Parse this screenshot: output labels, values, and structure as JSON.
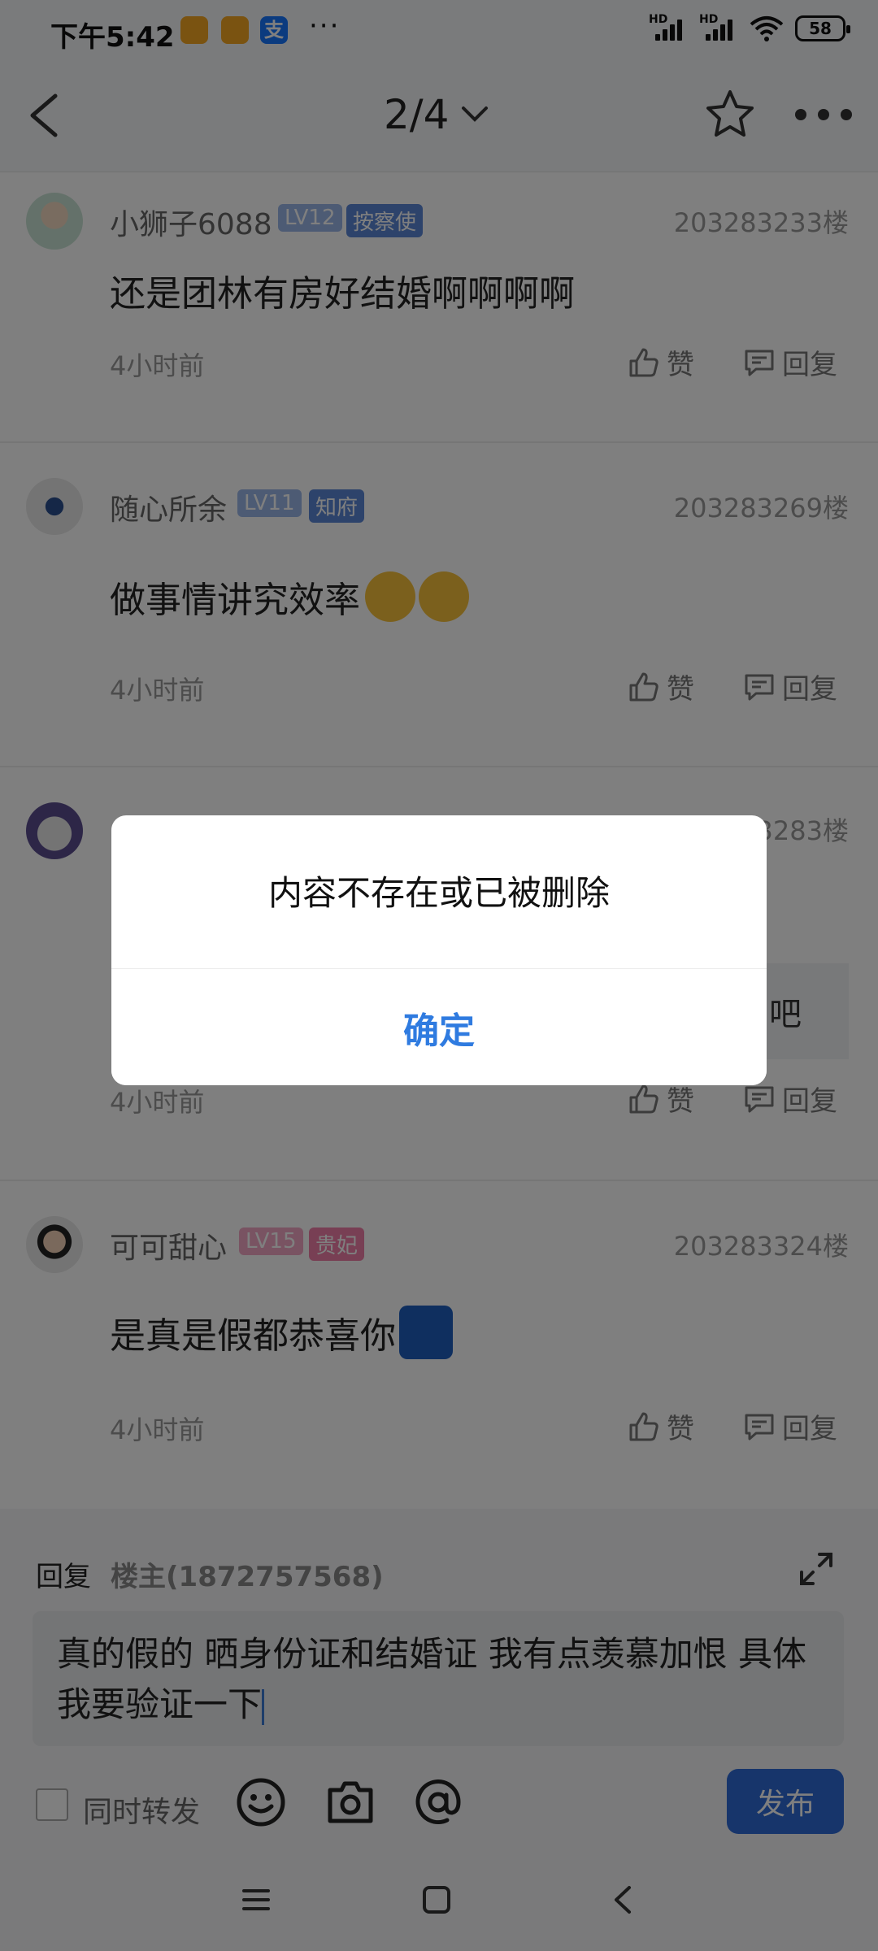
{
  "status_bar": {
    "time": "下午5:42",
    "more": "···",
    "battery": "58",
    "hd1": "HD",
    "hd2": "HD"
  },
  "nav": {
    "page_indicator": "2/4"
  },
  "comments": [
    {
      "user": "小狮子6088",
      "level": "LV12",
      "title": "按察使",
      "floor": "203283233楼",
      "text": "还是团林有房好结婚啊啊啊啊",
      "time": "4小时前",
      "like": "赞",
      "reply": "回复"
    },
    {
      "user": "随心所余",
      "level": "LV11",
      "title": "知府",
      "floor": "203283269楼",
      "text": "做事情讲究效率",
      "time": "4小时前",
      "like": "赞",
      "reply": "回复"
    },
    {
      "user": "",
      "level": "",
      "title": "",
      "floor": "3283楼",
      "text": "吧",
      "time": "4小时前",
      "like": "赞",
      "reply": "回复"
    },
    {
      "user": "可可甜心",
      "level": "LV15",
      "title": "贵妃",
      "floor": "203283324楼",
      "text": "是真是假都恭喜你",
      "time": "4小时前",
      "like": "赞",
      "reply": "回复"
    }
  ],
  "reply_panel": {
    "reply_label": "回复",
    "reply_to": "楼主(1872757568)",
    "input_text": "真的假的  晒身份证和结婚证  我有点羡慕加恨 具体我要验证一下",
    "forward_label": "同时转发",
    "publish_label": "发布"
  },
  "dialog": {
    "message": "内容不存在或已被删除",
    "confirm": "确定"
  },
  "colors": {
    "accent": "#2f7be0",
    "publish": "#2f6bd7",
    "lv_blue": "#9bb6e8",
    "title_blue": "#5b86d6",
    "lv_pink": "#f2a7c4",
    "title_pink": "#f07fa8"
  }
}
